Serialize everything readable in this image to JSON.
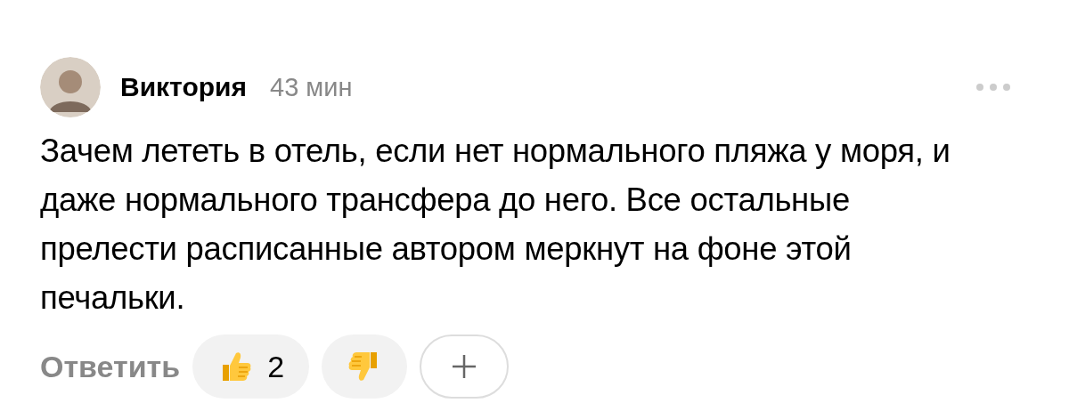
{
  "comment": {
    "author": "Виктория",
    "time": "43 мин",
    "text": "Зачем лететь в отель, если нет нормального пляжа у моря, и даже нормального трансфера до него. Все остальные прелести расписанные автором меркнут на фоне этой печальки."
  },
  "actions": {
    "reply": "Ответить",
    "reactions": [
      {
        "kind": "like",
        "count": "2"
      },
      {
        "kind": "dislike"
      }
    ]
  }
}
